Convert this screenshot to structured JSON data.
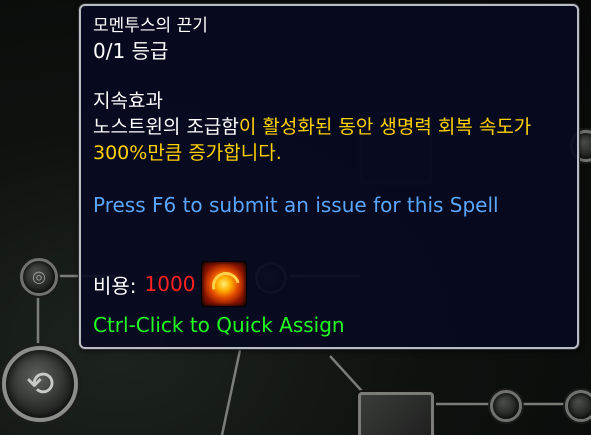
{
  "tooltip": {
    "spell_name": "모멘투스의 끈기",
    "rank": "0/1 등급",
    "section_title": "지속효과",
    "description_white": "노스트윈의 조급함",
    "description_yellow": "이 활성화된 동안 생명력 회복 속도가 300%만큼 증가합니다.",
    "report_text": "Press F6 to submit an issue for this Spell",
    "cost_label": "비용:",
    "cost_value": "1000",
    "cost_icon": "fire-swirl-icon",
    "assign_hint": "Ctrl-Click to Quick Assign"
  },
  "colors": {
    "tooltip_bg": "#080a20",
    "tooltip_border": "#b9bcc0",
    "description_yellow": "#ffd200",
    "report_blue": "#5aa6ff",
    "cost_red": "#ff2020",
    "assign_green": "#20ff20"
  }
}
